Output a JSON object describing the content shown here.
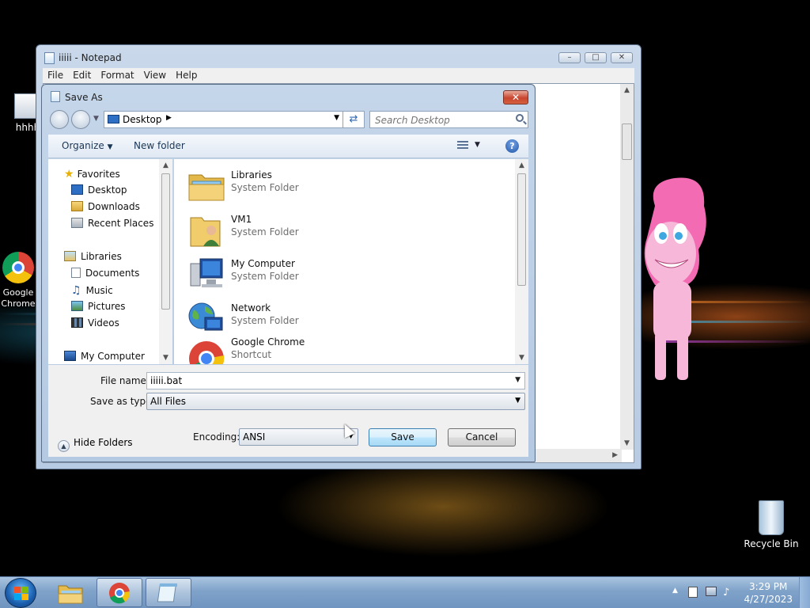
{
  "desktop": {
    "icons": [
      {
        "label": "hhhh"
      },
      {
        "label": "Google Chrome"
      },
      {
        "label": "Recycle Bin"
      }
    ]
  },
  "notepad": {
    "title": "iiiii - Notepad",
    "menu": [
      "File",
      "Edit",
      "Format",
      "View",
      "Help"
    ]
  },
  "save_dialog": {
    "title": "Save As",
    "address": "Desktop",
    "search_placeholder": "Search Desktop",
    "toolbar": {
      "organize": "Organize",
      "new_folder": "New folder"
    },
    "nav": {
      "favorites": "Favorites",
      "desktop": "Desktop",
      "downloads": "Downloads",
      "recent_places": "Recent Places",
      "libraries": "Libraries",
      "documents": "Documents",
      "music": "Music",
      "pictures": "Pictures",
      "videos": "Videos",
      "my_computer": "My Computer"
    },
    "files": [
      {
        "name": "Libraries",
        "type": "System Folder"
      },
      {
        "name": "VM1",
        "type": "System Folder"
      },
      {
        "name": "My Computer",
        "type": "System Folder"
      },
      {
        "name": "Network",
        "type": "System Folder"
      },
      {
        "name": "Google Chrome",
        "type": "Shortcut"
      }
    ],
    "file_name_label": "File name:",
    "file_name_value": "iiiii.bat",
    "save_as_type_label": "Save as type:",
    "save_as_type_value": "All Files",
    "encoding_label": "Encoding:",
    "encoding_value": "ANSI",
    "save_button": "Save",
    "cancel_button": "Cancel",
    "hide_folders": "Hide Folders"
  },
  "taskbar": {
    "time": "3:29 PM",
    "date": "4/27/2023"
  },
  "colors": {
    "accent": "#3c7fb1",
    "close_red": "#c8452f",
    "taskbar": "#7fa2c9"
  }
}
